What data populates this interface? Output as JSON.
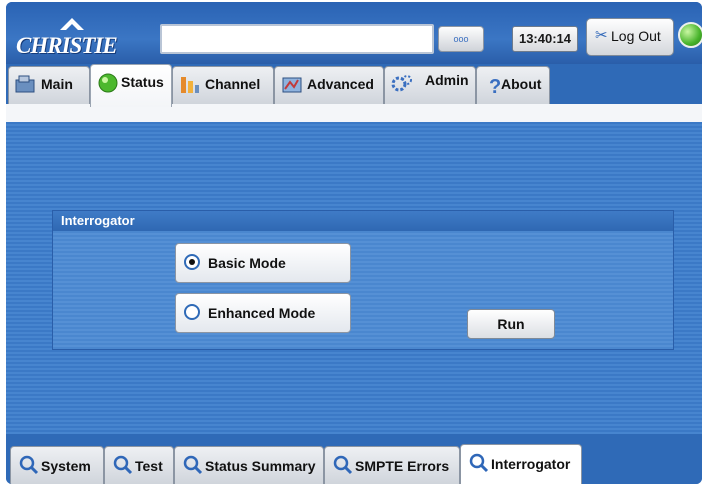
{
  "header": {
    "logo_text": "CHRISTIE",
    "message": "",
    "dots_label": "ooo",
    "time": "13:40:14",
    "logout_label": "Log Out",
    "status_led_color": "#47b32a"
  },
  "tabs": [
    {
      "label": "Main",
      "icon": "projector-icon"
    },
    {
      "label": "Status",
      "icon": "status-led-icon",
      "active": true
    },
    {
      "label": "Channel",
      "icon": "channel-icon"
    },
    {
      "label": "Advanced",
      "icon": "advanced-icon"
    },
    {
      "label": "Admin",
      "icon": "gears-icon"
    },
    {
      "label": "About",
      "icon": "question-icon"
    }
  ],
  "panel": {
    "title": "Interrogator",
    "options": [
      {
        "label": "Basic Mode",
        "selected": true
      },
      {
        "label": "Enhanced Mode",
        "selected": false
      }
    ],
    "run_label": "Run"
  },
  "bottom_tabs": [
    {
      "label": "System"
    },
    {
      "label": "Test"
    },
    {
      "label": "Status Summary"
    },
    {
      "label": "SMPTE Errors"
    },
    {
      "label": "Interrogator",
      "active": true
    }
  ],
  "colors": {
    "accent": "#2f6ab7",
    "panel": "#4a87cf"
  }
}
